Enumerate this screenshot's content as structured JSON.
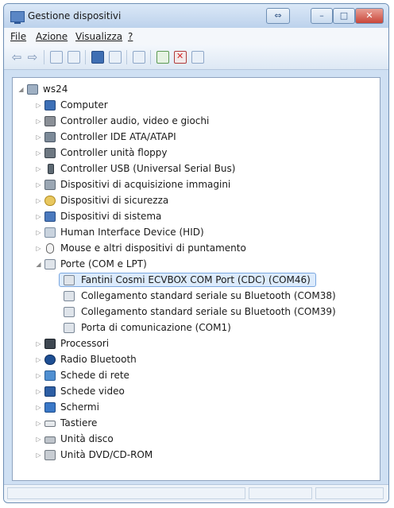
{
  "window": {
    "title": "Gestione dispositivi",
    "controls": {
      "restore": "⇔",
      "minimize": "–",
      "maximize": "□",
      "close": "✕"
    }
  },
  "menu": [
    {
      "label": "File"
    },
    {
      "label": "Azione"
    },
    {
      "label": "Visualizza"
    },
    {
      "label": "?"
    }
  ],
  "toolbar": {
    "icons": [
      "back-arrow-icon",
      "forward-arrow-icon",
      "properties-icon",
      "help-icon",
      "scan-icon",
      "update-driver-icon",
      "disable-icon",
      "uninstall-icon",
      "rollback-icon"
    ],
    "back_glyph": "⇦",
    "forward_glyph": "⇨"
  },
  "tree": {
    "root": "ws24",
    "expander_open": "◢",
    "expander_closed": "▷",
    "categories": [
      {
        "label": "Computer",
        "icon": "computer-icon"
      },
      {
        "label": "Controller audio, video e giochi",
        "icon": "audio-controller-icon"
      },
      {
        "label": "Controller IDE ATA/ATAPI",
        "icon": "ide-controller-icon"
      },
      {
        "label": "Controller unità floppy",
        "icon": "floppy-controller-icon"
      },
      {
        "label": "Controller USB (Universal Serial Bus)",
        "icon": "usb-icon"
      },
      {
        "label": "Dispositivi di acquisizione immagini",
        "icon": "imaging-device-icon"
      },
      {
        "label": "Dispositivi di sicurezza",
        "icon": "security-device-icon"
      },
      {
        "label": "Dispositivi di sistema",
        "icon": "system-device-icon"
      },
      {
        "label": "Human Interface Device (HID)",
        "icon": "hid-icon"
      },
      {
        "label": "Mouse e altri dispositivi di puntamento",
        "icon": "mouse-icon"
      },
      {
        "label": "Porte (COM e LPT)",
        "icon": "port-icon",
        "children": [
          {
            "label": "Fantini Cosmi ECVBOX COM Port (CDC) (COM46)",
            "selected": true
          },
          {
            "label": "Collegamento standard seriale su Bluetooth (COM38)"
          },
          {
            "label": "Collegamento standard seriale su Bluetooth (COM39)"
          },
          {
            "label": "Porta di comunicazione (COM1)"
          }
        ]
      },
      {
        "label": "Processori",
        "icon": "processor-icon"
      },
      {
        "label": "Radio Bluetooth",
        "icon": "bluetooth-icon"
      },
      {
        "label": "Schede di rete",
        "icon": "network-adapter-icon"
      },
      {
        "label": "Schede video",
        "icon": "display-adapter-icon"
      },
      {
        "label": "Schermi",
        "icon": "monitor-icon"
      },
      {
        "label": "Tastiere",
        "icon": "keyboard-icon"
      },
      {
        "label": "Unità disco",
        "icon": "disk-drive-icon"
      },
      {
        "label": "Unità DVD/CD-ROM",
        "icon": "dvd-drive-icon"
      }
    ]
  }
}
